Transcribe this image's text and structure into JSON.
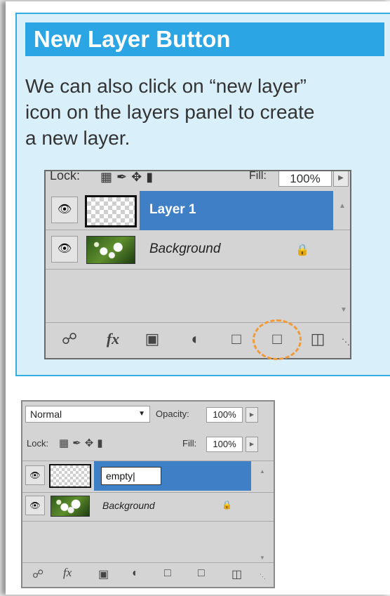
{
  "card": {
    "title": "New Layer Button",
    "body_line1": "We can also click on “new layer”",
    "body_line2": "icon on the layers panel to create",
    "body_line3": "a new layer."
  },
  "panel_large": {
    "lock_label": "Lock:",
    "fill_label": "Fill:",
    "fill_value": "100%",
    "layers": [
      {
        "name": "Layer 1",
        "selected": true
      },
      {
        "name": "Background",
        "selected": false,
        "locked": true
      }
    ],
    "tools": [
      "link-icon",
      "fx-icon",
      "mask-icon",
      "adjustment-icon",
      "folder-icon",
      "new-layer-icon",
      "trash-icon"
    ],
    "fx_text": "fx",
    "highlight_color": "#f09a38"
  },
  "panel_small": {
    "blend_mode": "Normal",
    "opacity_label": "Opacity:",
    "opacity_value": "100%",
    "lock_label": "Lock:",
    "fill_label": "Fill:",
    "fill_value": "100%",
    "editing_name": "empty",
    "background_name": "Background",
    "fx_text": "fx"
  },
  "colors": {
    "accent": "#2ba5e3",
    "card_bg": "#d9f0fb",
    "selected_layer": "#3f7fc6"
  }
}
